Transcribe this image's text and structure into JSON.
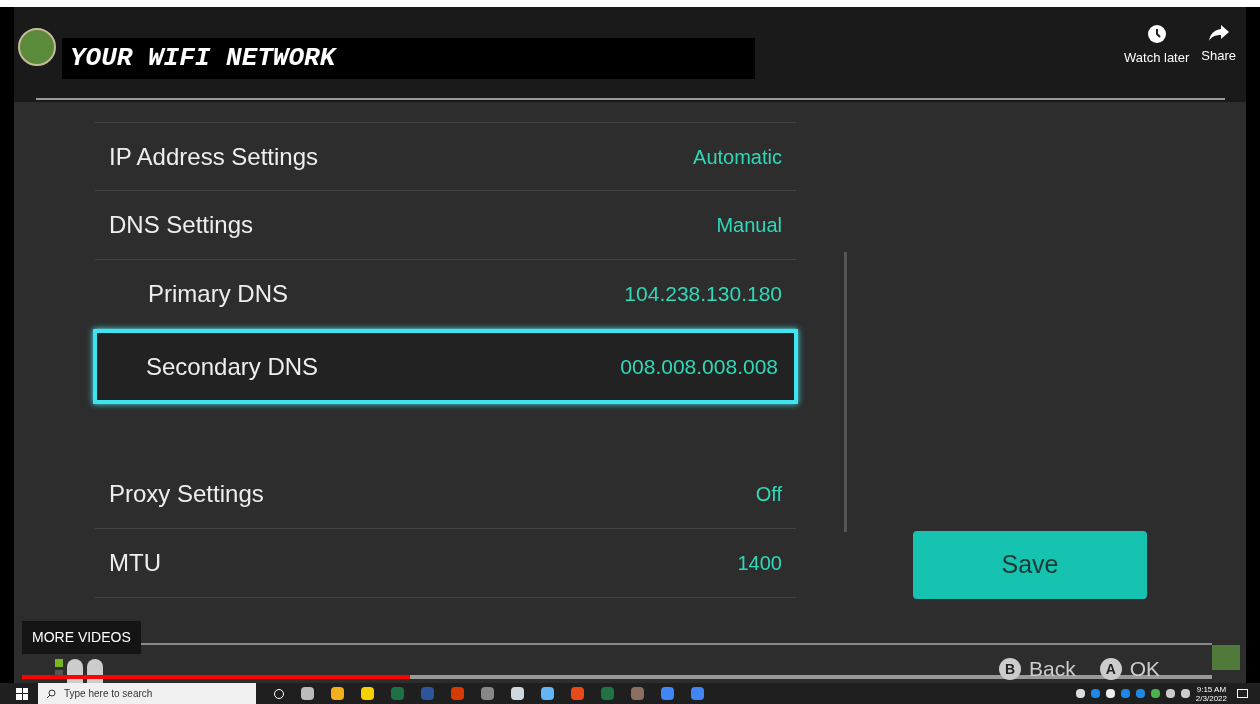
{
  "video_title": "YOUR WIFI NETWORK",
  "actions": [
    {
      "kind": "clock",
      "label": "Watch later"
    },
    {
      "kind": "share",
      "label": "Share"
    }
  ],
  "settings": [
    {
      "label": "IP Address Settings",
      "value": "Automatic",
      "kind": "main",
      "selected": false
    },
    {
      "label": "DNS Settings",
      "value": "Manual",
      "kind": "main",
      "selected": false
    },
    {
      "label": "Primary DNS",
      "value": "104.238.130.180",
      "kind": "sub",
      "selected": false
    },
    {
      "label": "Secondary DNS",
      "value": "008.008.008.008",
      "kind": "sub",
      "selected": true
    },
    {
      "label": "Proxy Settings",
      "value": "Off",
      "kind": "main",
      "selected": false
    },
    {
      "label": "MTU",
      "value": "1400",
      "kind": "main",
      "selected": false
    }
  ],
  "save_button": "Save",
  "more_videos": "MORE VIDEOS",
  "progress": {
    "level": 0.326
  },
  "footer_buttons": [
    {
      "key": "B",
      "label": "Back"
    },
    {
      "key": "A",
      "label": "OK"
    }
  ],
  "taskbar": {
    "search_placeholder": "Type here to search",
    "time": "9:15 AM",
    "date": "2/3/2022"
  }
}
